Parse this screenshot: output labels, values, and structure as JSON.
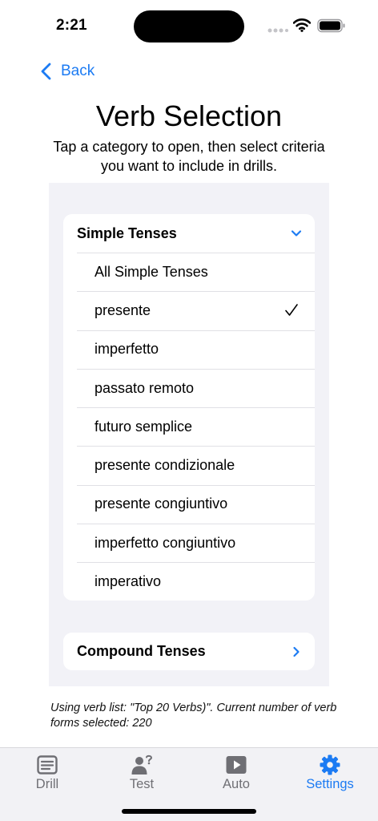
{
  "status_bar": {
    "time": "2:21"
  },
  "nav": {
    "back_label": "Back"
  },
  "header": {
    "title": "Verb Selection",
    "subtitle": "Tap a category to open, then select criteria you want to include in drills."
  },
  "sections": {
    "simple": {
      "label": "Simple Tenses",
      "expanded": true,
      "items": [
        {
          "label": "All Simple Tenses",
          "checked": false
        },
        {
          "label": "presente",
          "checked": true
        },
        {
          "label": "imperfetto",
          "checked": false
        },
        {
          "label": "passato remoto",
          "checked": false
        },
        {
          "label": "futuro semplice",
          "checked": false
        },
        {
          "label": "presente condizionale",
          "checked": false
        },
        {
          "label": "presente congiuntivo",
          "checked": false
        },
        {
          "label": "imperfetto congiuntivo",
          "checked": false
        },
        {
          "label": "imperativo",
          "checked": false
        }
      ]
    },
    "compound": {
      "label": "Compound Tenses",
      "expanded": false
    }
  },
  "footer_note": "Using verb list: \"Top 20 Verbs)\". Current number of verb forms selected: 220",
  "tabs": {
    "drill": {
      "label": "Drill",
      "icon": "list-card-icon"
    },
    "test": {
      "label": "Test",
      "icon": "person-question-icon"
    },
    "auto": {
      "label": "Auto",
      "icon": "play-icon"
    },
    "settings": {
      "label": "Settings",
      "icon": "gear-icon",
      "active": true
    }
  },
  "colors": {
    "accent": "#1c7bf3",
    "panel_background": "#f2f2f7",
    "tab_inactive": "#707075"
  }
}
